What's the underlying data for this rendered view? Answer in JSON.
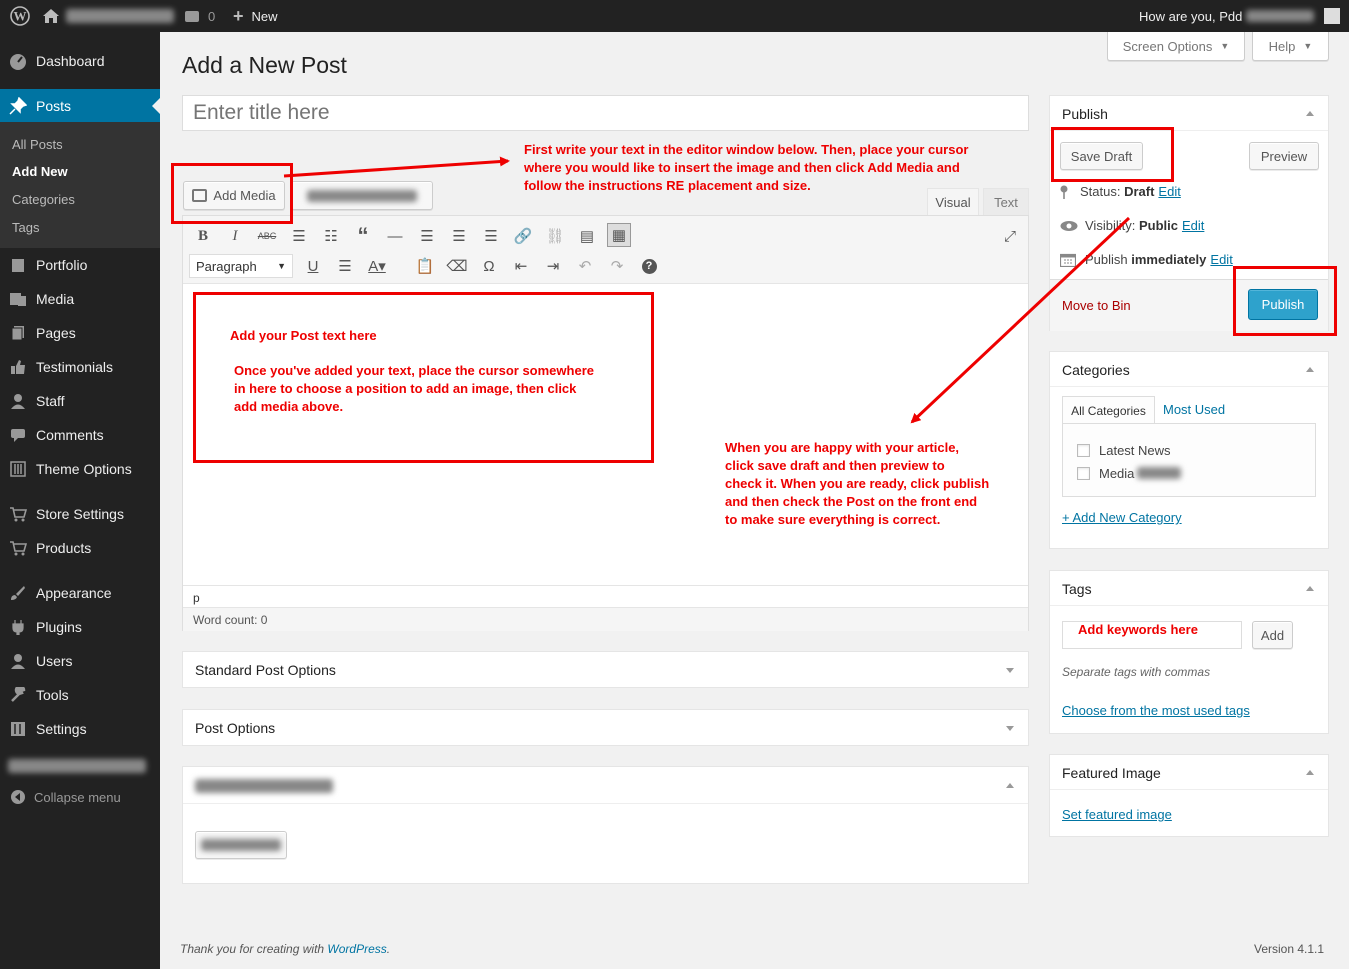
{
  "adminbar": {
    "comments_count": "0",
    "new_label": "New",
    "greeting": "How are you, Pdd"
  },
  "sidebar": {
    "items": [
      {
        "label": "Dashboard"
      },
      {
        "label": "Posts"
      },
      {
        "label": "Portfolio"
      },
      {
        "label": "Media"
      },
      {
        "label": "Pages"
      },
      {
        "label": "Testimonials"
      },
      {
        "label": "Staff"
      },
      {
        "label": "Comments"
      },
      {
        "label": "Theme Options"
      },
      {
        "label": "Store Settings"
      },
      {
        "label": "Products"
      },
      {
        "label": "Appearance"
      },
      {
        "label": "Plugins"
      },
      {
        "label": "Users"
      },
      {
        "label": "Tools"
      },
      {
        "label": "Settings"
      }
    ],
    "submenu": [
      "All Posts",
      "Add New",
      "Categories",
      "Tags"
    ],
    "collapse": "Collapse menu"
  },
  "header": {
    "screen_options": "Screen Options",
    "help": "Help"
  },
  "page": {
    "title": "Add a New Post",
    "title_placeholder": "Enter title here"
  },
  "editor": {
    "add_media": "Add Media",
    "tab_visual": "Visual",
    "tab_text": "Text",
    "format_select": "Paragraph",
    "path": "p",
    "word_count": "Word count: 0"
  },
  "metaboxes": {
    "standard_post_options": "Standard Post Options",
    "post_options": "Post Options"
  },
  "publish": {
    "title": "Publish",
    "save_draft": "Save Draft",
    "preview": "Preview",
    "status_label": "Status: ",
    "status_value": "Draft",
    "status_edit": "Edit",
    "visibility_label": "Visibility: ",
    "visibility_value": "Public",
    "visibility_edit": "Edit",
    "schedule_label": "Publish ",
    "schedule_value": "immediately",
    "schedule_edit": "Edit",
    "move_to_bin": "Move to Bin",
    "publish_button": "Publish"
  },
  "categories": {
    "title": "Categories",
    "tab_all": "All Categories",
    "tab_most_used": "Most Used",
    "items": [
      "Latest News",
      "Media"
    ],
    "add_new": "+ Add New Category"
  },
  "tags": {
    "title": "Tags",
    "add_button": "Add",
    "hint": "Separate tags with commas",
    "choose": "Choose from the most used tags"
  },
  "featured_image": {
    "title": "Featured Image",
    "set": "Set featured image"
  },
  "annotations": {
    "top_line1": "First write your text in the editor window below.  Then, place your cursor",
    "top_line2": "where you would like to insert the image and then click Add Media and",
    "top_line3": "follow the instructions RE placement and size.",
    "editor_title": "Add your Post text here",
    "editor_line1": "Once you've added your text, place the cursor somewhere",
    "editor_line2": "in here to choose a position to add an image, then click",
    "editor_line3": "add media above.",
    "right_line1": "When you are happy with your article,",
    "right_line2": "click save draft and then preview to",
    "right_line3": "check it.  When you are ready, click publish",
    "right_line4": "and then check the Post on the front end",
    "right_line5": "to make sure everything is correct.",
    "tags_hint": "Add keywords here"
  },
  "footer": {
    "thanks": "Thank you for creating with ",
    "wp_link": "WordPress",
    "period": ".",
    "version": "Version 4.1.1"
  }
}
